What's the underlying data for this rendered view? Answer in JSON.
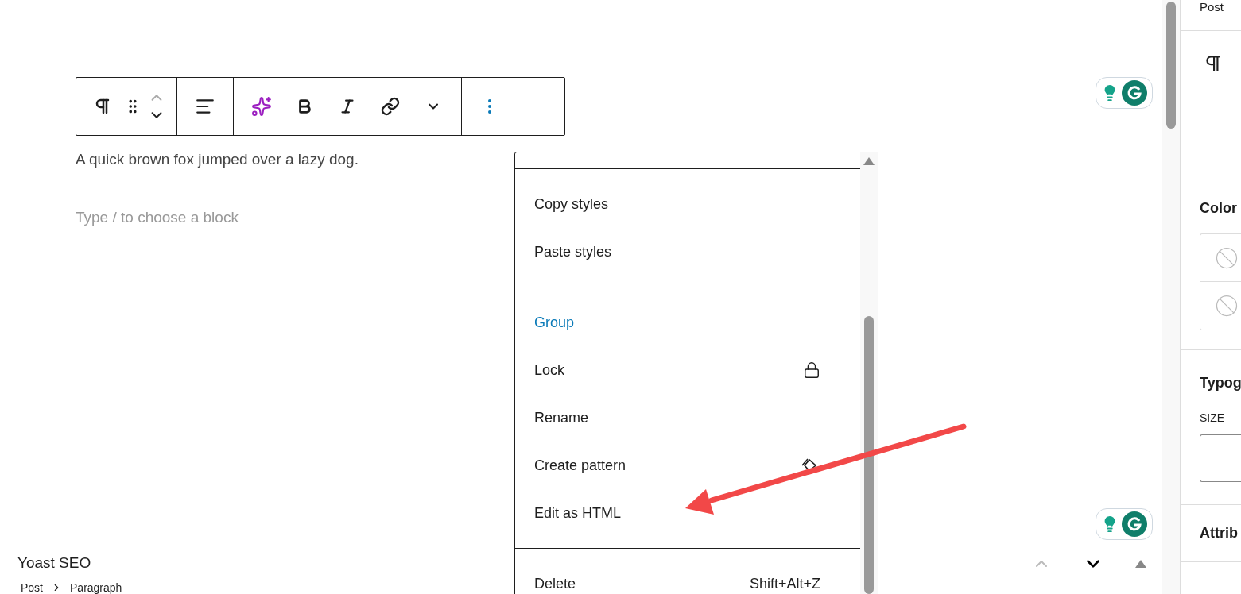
{
  "editor": {
    "paragraph": "A quick brown fox jumped over a lazy dog.",
    "placeholder": "Type / to choose a block"
  },
  "block_menu": {
    "sections": [
      [
        {
          "label": "Copy styles",
          "kind": "plain",
          "selected": false
        },
        {
          "label": "Paste styles",
          "kind": "plain",
          "selected": false
        }
      ],
      [
        {
          "label": "Group",
          "kind": "plain",
          "selected": true
        },
        {
          "label": "Lock",
          "kind": "lock",
          "selected": false
        },
        {
          "label": "Rename",
          "kind": "plain",
          "selected": false
        },
        {
          "label": "Create pattern",
          "kind": "pattern",
          "selected": false
        },
        {
          "label": "Edit as HTML",
          "kind": "plain",
          "selected": false
        }
      ],
      [
        {
          "label": "Delete",
          "kind": "shortcut",
          "shortcut": "Shift+Alt+Z",
          "selected": false
        }
      ]
    ]
  },
  "bottom_panel": {
    "title": "Yoast SEO"
  },
  "breadcrumb": [
    "Post",
    "Paragraph"
  ],
  "sidebar": {
    "top_tab": "Post",
    "color_heading": "Color",
    "typography_heading": "Typog",
    "size_label": "SIZE",
    "attributes_heading": "Attrib"
  }
}
